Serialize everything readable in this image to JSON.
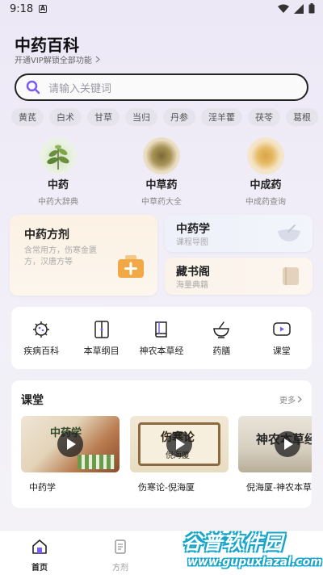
{
  "status_bar": {
    "time": "9:18",
    "notification_letter": "A"
  },
  "header": {
    "title": "中药百科",
    "vip_link": "开通VIP解锁全部功能"
  },
  "search": {
    "placeholder": "请输入关键词"
  },
  "tags": [
    "黄芪",
    "白术",
    "甘草",
    "当归",
    "丹参",
    "淫羊藿",
    "茯苓",
    "葛根"
  ],
  "categories": [
    {
      "title": "中药",
      "subtitle": "中药大辞典"
    },
    {
      "title": "中草药",
      "subtitle": "中草药大全"
    },
    {
      "title": "中成药",
      "subtitle": "中成药查询"
    }
  ],
  "cards": {
    "formula": {
      "title": "中药方剂",
      "desc": "含常用方，伤寒金匮方，汉唐方等"
    },
    "study": {
      "title": "中药学",
      "subtitle": "课程导图"
    },
    "library": {
      "title": "藏书阁",
      "subtitle": "海量典籍"
    }
  },
  "tools": [
    {
      "label": "疾病百科",
      "icon": "virus-icon"
    },
    {
      "label": "本草纲目",
      "icon": "book-open-icon"
    },
    {
      "label": "神农本草经",
      "icon": "book-icon"
    },
    {
      "label": "药膳",
      "icon": "mortar-icon"
    },
    {
      "label": "课堂",
      "icon": "play-screen-icon"
    }
  ],
  "classroom": {
    "title": "课堂",
    "more": "更多",
    "courses": [
      {
        "label": "中药学",
        "thumb_text": "中药学"
      },
      {
        "label": "伤寒论-倪海厦",
        "thumb_text": "伤寒论",
        "thumb_sub": "倪海厦"
      },
      {
        "label": "倪海厦-神农本草",
        "thumb_text": "神农本草经"
      }
    ]
  },
  "bottom_nav": [
    {
      "label": "首页",
      "active": true
    },
    {
      "label": "方剂",
      "active": false
    }
  ],
  "watermark": {
    "title": "谷普软件园",
    "url": "www.gupuxlazal.com"
  },
  "colors": {
    "accent": "#7b5cf0",
    "card_orange": "#f2a945",
    "watermark": "#17a5c9"
  }
}
